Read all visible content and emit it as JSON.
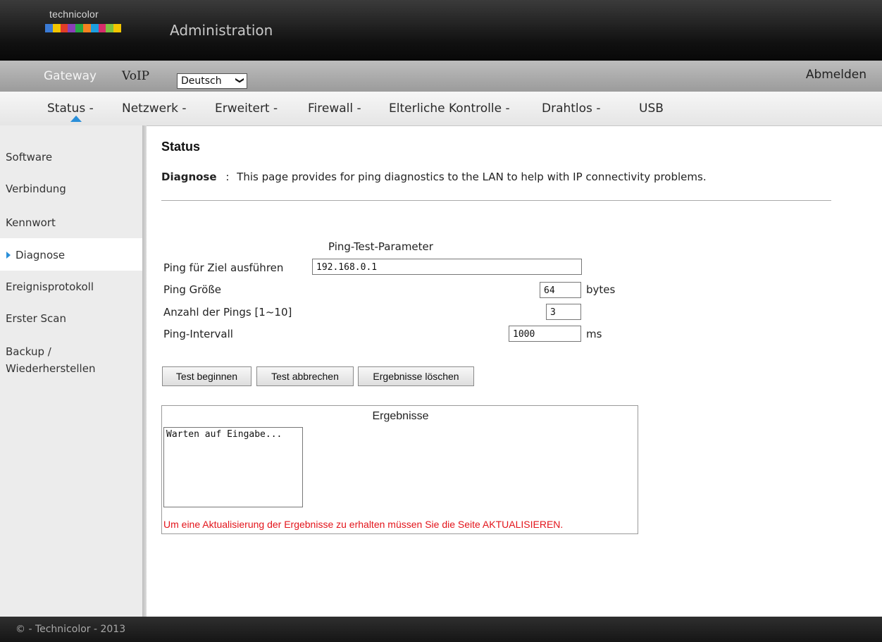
{
  "header": {
    "logo_text": "technicolor",
    "logo_colors": [
      "#3a7bd5",
      "#f2c500",
      "#e23d28",
      "#8b3fb8",
      "#27a844",
      "#f58220",
      "#1c9fe0",
      "#d62d6b",
      "#7cc242",
      "#f2c500"
    ],
    "app_title": "Administration"
  },
  "subnav": {
    "gateway_label": "Gateway",
    "voip_label": "VoIP",
    "language_selected": "Deutsch",
    "language_chevron": "❯",
    "logout_label": "Abmelden"
  },
  "nav": {
    "items": [
      "Status -",
      "Netzwerk -",
      "Erweitert -",
      "Firewall -",
      "Elterliche Kontrolle -",
      "Drahtlos -",
      "USB"
    ],
    "active": "Status -",
    "accent": "#2a8fd9"
  },
  "sidebar": {
    "items": [
      "Software",
      "Verbindung",
      "Kennwort",
      "Diagnose",
      "Ereignisprotokoll",
      "Erster Scan",
      "Backup /",
      "Wiederherstellen"
    ],
    "active": "Diagnose"
  },
  "main": {
    "title": "Status",
    "desc_label": "Diagnose",
    "desc_sep": ":",
    "desc_text": "This page provides for ping diagnostics to the LAN to help with IP connectivity problems.",
    "params_title": "Ping-Test-Parameter",
    "target_label": "Ping für Ziel ausführen",
    "target_value": "192.168.0.1",
    "size_label": "Ping Größe",
    "size_value": "64",
    "size_unit": "bytes",
    "count_label": "Anzahl der Pings [1~10]",
    "count_value": "3",
    "interval_label": "Ping-Intervall",
    "interval_value": "1000",
    "interval_unit": "ms",
    "buttons": {
      "start": "Test beginnen",
      "cancel": "Test abbrechen",
      "clear": "Ergebnisse löschen"
    },
    "results_title": "Ergebnisse",
    "results_text": "Warten auf Eingabe...",
    "results_note": "Um eine Aktualisierung der Ergebnisse zu erhalten müssen Sie die Seite AKTUALISIEREN.",
    "note_color": "#e3141b"
  },
  "footer": {
    "text": "© - Technicolor - 2013"
  }
}
